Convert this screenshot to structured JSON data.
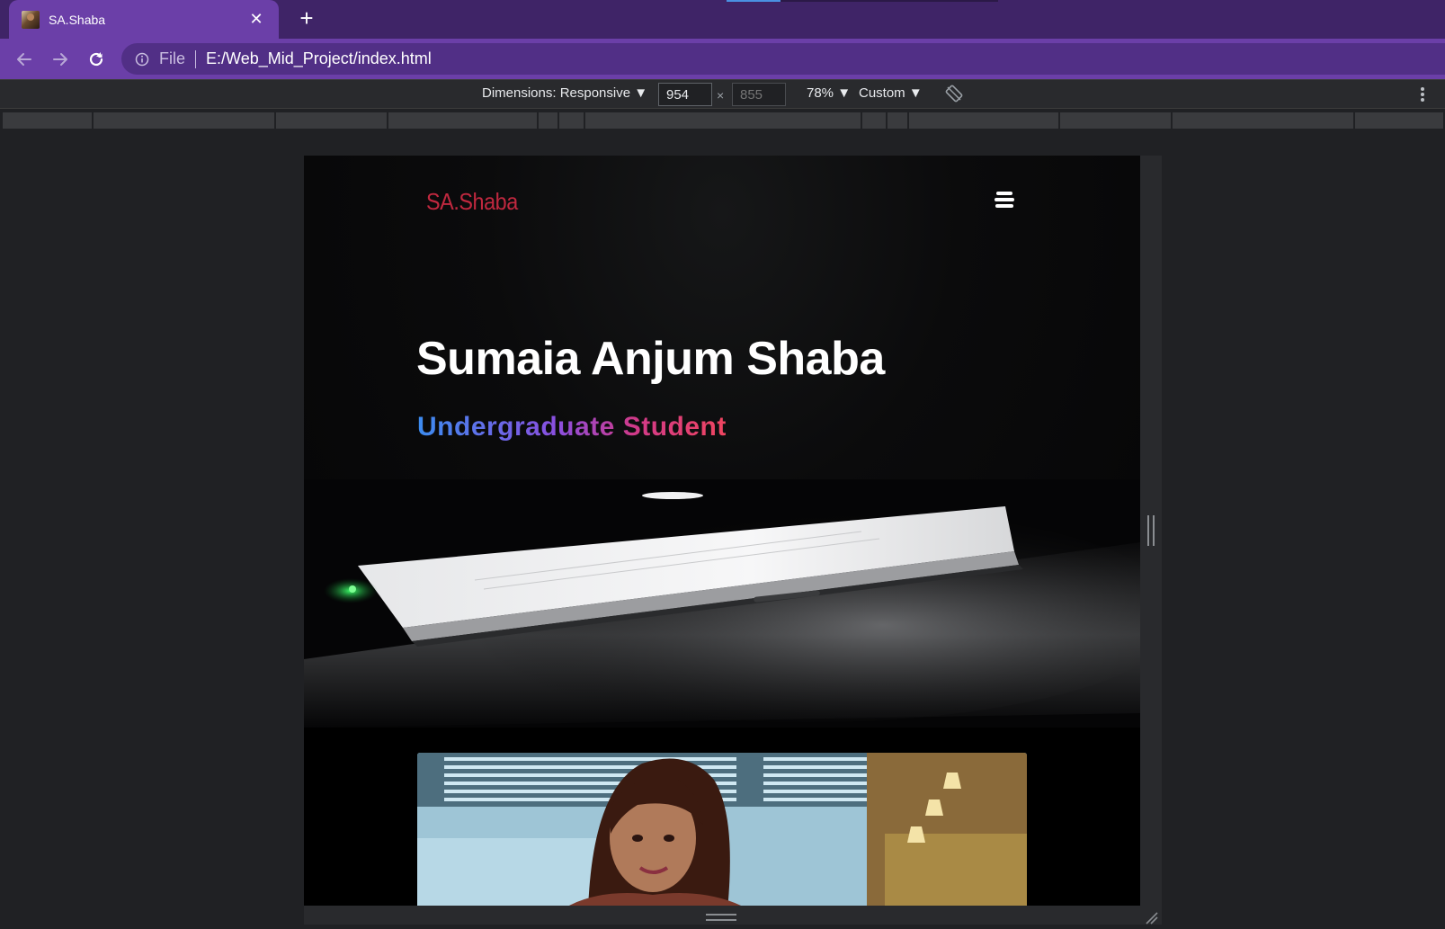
{
  "browser": {
    "tab": {
      "title": "SA.Shaba",
      "close_label": "✕",
      "favicon": "profile-photo-favicon"
    },
    "new_tab_label": "+",
    "nav": {
      "back_icon": "arrow-left-icon",
      "forward_icon": "arrow-right-icon",
      "reload_icon": "reload-icon"
    },
    "omnibox": {
      "scheme_label": "File",
      "url": "E:/Web_Mid_Project/index.html",
      "info_icon": "info-icon"
    },
    "theme": {
      "tabstrip_bg": "#3f2467",
      "toolbar_bg": "#6b3fa8",
      "omnibox_bg": "#512f86"
    }
  },
  "device_toolbar": {
    "dimensions_label": "Dimensions: Responsive ▼",
    "width_value": "954",
    "height_placeholder": "855",
    "times_sign": "×",
    "zoom_label": "78% ▼",
    "throttle_label": "Custom ▼",
    "rotate_icon": "rotate-icon",
    "more_icon": "kebab-menu-icon"
  },
  "site": {
    "logo": "SA.Shaba",
    "menu_icon": "hamburger-menu-icon",
    "hero": {
      "name": "Sumaia Anjum Shaba",
      "role": "Undergraduate Student"
    },
    "colors": {
      "logo": "#c0283f",
      "role_gradient_start": "#3c8cf0",
      "role_gradient_end": "#f04560"
    },
    "images": {
      "hero_background": "laptop-on-desk-dark-photo",
      "portrait": "profile-portrait-photo"
    }
  }
}
